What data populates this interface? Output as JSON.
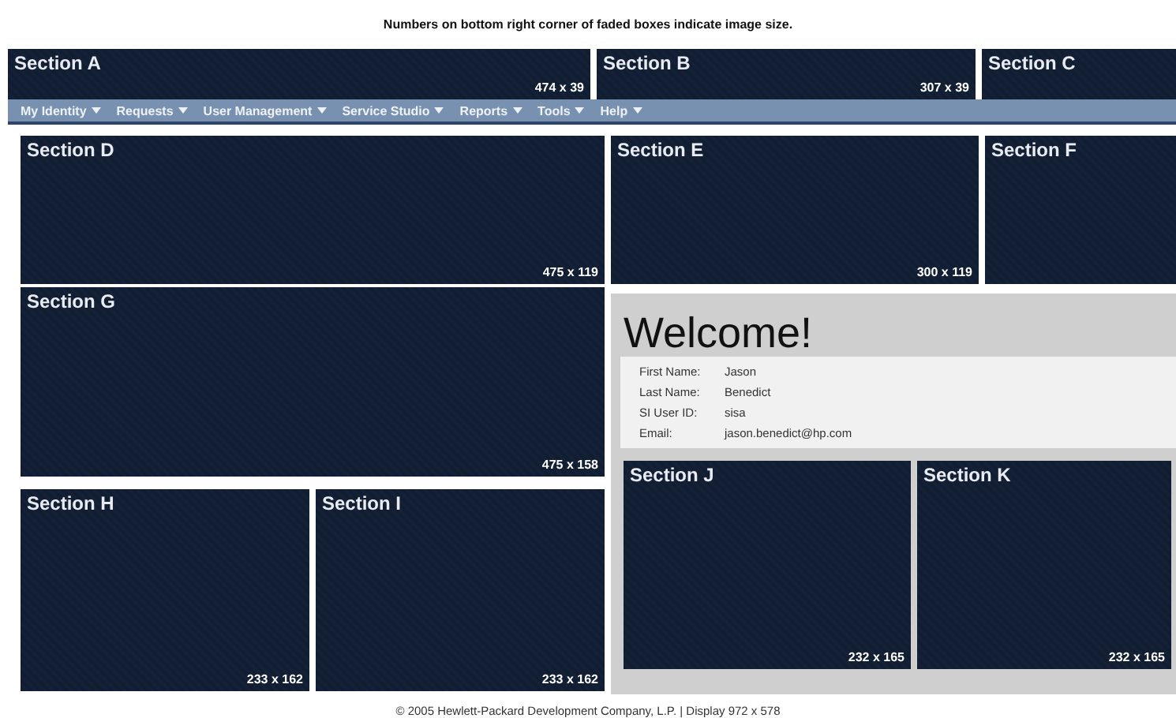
{
  "notice": "Numbers on bottom right corner of faded boxes indicate image size.",
  "top_sections": [
    {
      "label": "Section A",
      "size": "474 x 39"
    },
    {
      "label": "Section B",
      "size": "307 x 39"
    },
    {
      "label": "Section C"
    }
  ],
  "menu": [
    "My Identity",
    "Requests",
    "User Management",
    "Service Studio",
    "Reports",
    "Tools",
    "Help"
  ],
  "left_sections": [
    {
      "label": "Section D",
      "size": "475 x 119"
    },
    {
      "label": "Section G",
      "size": "475 x 158"
    }
  ],
  "bottom_left_sections": [
    {
      "label": "Section H",
      "size": "233 x 162"
    },
    {
      "label": "Section I",
      "size": "233 x 162"
    }
  ],
  "right_top_sections": [
    {
      "label": "Section E",
      "size": "300 x 119"
    },
    {
      "label": "Section F"
    }
  ],
  "welcome": {
    "title": "Welcome!",
    "fields": [
      {
        "label": "First Name:",
        "value": "Jason"
      },
      {
        "label": "Last Name:",
        "value": "Benedict"
      },
      {
        "label": "SI User ID:",
        "value": "sisa"
      },
      {
        "label": "Email:",
        "value": "jason.benedict@hp.com"
      }
    ]
  },
  "welcome_sections": [
    {
      "label": "Section J",
      "size": "232 x 165"
    },
    {
      "label": "Section K",
      "size": "232 x 165"
    }
  ],
  "footer": "© 2005 Hewlett-Packard Development Company, L.P.  |  Display 972 x 578"
}
